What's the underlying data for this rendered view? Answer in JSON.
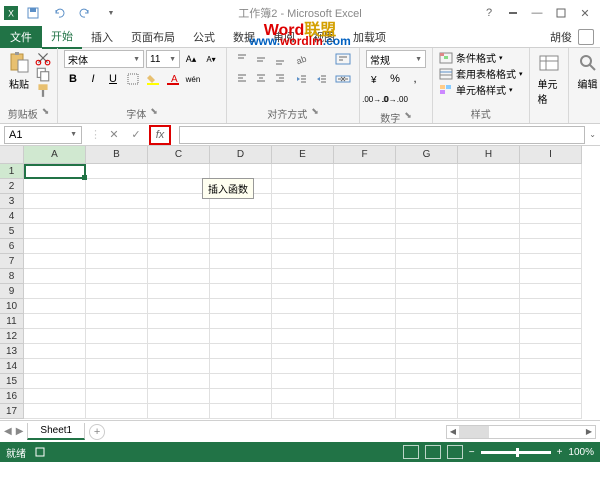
{
  "titlebar": {
    "title": "工作簿2 - Microsoft Excel",
    "qat": [
      "save",
      "undo",
      "redo"
    ]
  },
  "watermark": {
    "text1_a": "Word",
    "text1_b": "联盟",
    "text2_a": "www.",
    "text2_b": "wordlm",
    "text2_c": ".com"
  },
  "tabs": {
    "file": "文件",
    "items": [
      "开始",
      "插入",
      "页面布局",
      "公式",
      "数据",
      "审阅",
      "视图",
      "加载项"
    ],
    "active_index": 0,
    "user": "胡俊"
  },
  "ribbon": {
    "clipboard": {
      "label": "剪贴板",
      "paste": "粘贴"
    },
    "font": {
      "label": "字体",
      "name": "宋体",
      "size": "11",
      "bold": "B",
      "italic": "I",
      "underline": "U",
      "pinyin": "wén"
    },
    "align": {
      "label": "对齐方式"
    },
    "number": {
      "label": "数字",
      "format": "常规"
    },
    "styles": {
      "label": "样式",
      "cond_format": "条件格式",
      "table_format": "套用表格格式",
      "cell_styles": "单元格样式"
    },
    "cells": {
      "label": "单元格"
    },
    "editing": {
      "label": "编辑"
    }
  },
  "fx": {
    "name_box": "A1",
    "tooltip": "插入函数"
  },
  "grid": {
    "columns": [
      "A",
      "B",
      "C",
      "D",
      "E",
      "F",
      "G",
      "H",
      "I"
    ],
    "rows": [
      1,
      2,
      3,
      4,
      5,
      6,
      7,
      8,
      9,
      10,
      11,
      12,
      13,
      14,
      15,
      16,
      17
    ],
    "selected_cell": "A1"
  },
  "sheets": {
    "active": "Sheet1"
  },
  "statusbar": {
    "ready": "就绪",
    "zoom": "100%"
  },
  "chart_data": null
}
